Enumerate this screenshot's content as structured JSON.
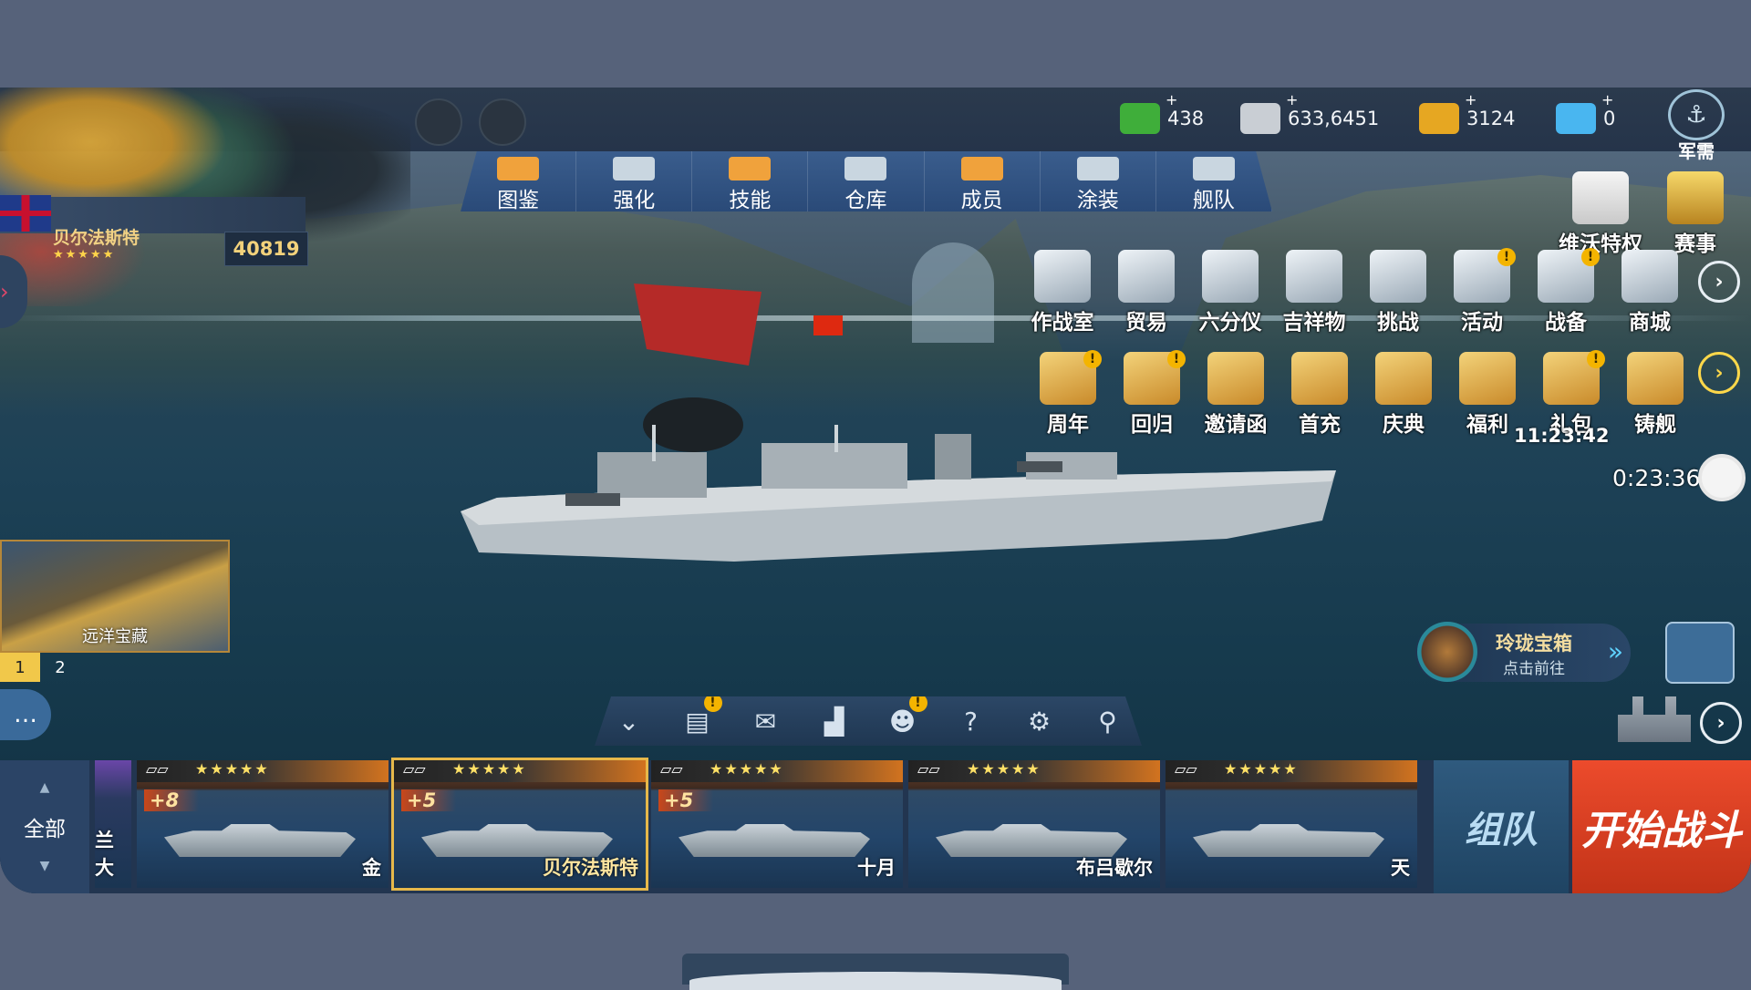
{
  "resources": [
    {
      "icon": "cash-icon",
      "value": "438",
      "color": "#3fae3a"
    },
    {
      "icon": "silver-coins-icon",
      "value": "633,6451",
      "color": "#c9ced4"
    },
    {
      "icon": "gold-coins-icon",
      "value": "3124",
      "color": "#e6a722"
    },
    {
      "icon": "diamond-icon",
      "value": "0",
      "color": "#49b6f0"
    }
  ],
  "resource_plus": "+",
  "junxu_label": "军需",
  "player": {
    "name": "贝尔法斯特",
    "stars": "★★★★★",
    "power": "40819"
  },
  "tabs": [
    {
      "label": "图鉴",
      "icon": "book-icon",
      "color": "#f0a23c"
    },
    {
      "label": "强化",
      "icon": "upgrade-icon",
      "color": "#c9d6e0"
    },
    {
      "label": "技能",
      "icon": "skill-icon",
      "color": "#f0a23c"
    },
    {
      "label": "仓库",
      "icon": "warehouse-icon",
      "color": "#c9d6e0"
    },
    {
      "label": "成员",
      "icon": "crew-icon",
      "color": "#f0a23c"
    },
    {
      "label": "涂装",
      "icon": "paint-flag-icon",
      "color": "#c9d6e0"
    },
    {
      "label": "舰队",
      "icon": "fleet-flag-icon",
      "color": "#c9d6e0"
    }
  ],
  "top_right": [
    {
      "label": "维沃特权",
      "icon": "phone-privilege-icon"
    },
    {
      "label": "赛事",
      "icon": "trophy-icon"
    }
  ],
  "menu_row1": [
    {
      "label": "作战室",
      "icon": "war-room-icon",
      "badge": ""
    },
    {
      "label": "贸易",
      "icon": "scale-icon",
      "badge": ""
    },
    {
      "label": "六分仪",
      "icon": "sextant-icon",
      "badge": ""
    },
    {
      "label": "吉祥物",
      "icon": "mascot-icon",
      "badge": ""
    },
    {
      "label": "挑战",
      "icon": "challenge-wings-icon",
      "badge": ""
    },
    {
      "label": "活动",
      "icon": "megaphone-icon",
      "badge": "!"
    },
    {
      "label": "战备",
      "icon": "book-supply-icon",
      "badge": "!"
    },
    {
      "label": "商城",
      "icon": "cart-icon",
      "badge": ""
    }
  ],
  "menu_row2": [
    {
      "label": "周年",
      "icon": "anniversary-gift-icon",
      "badge": "!"
    },
    {
      "label": "回归",
      "icon": "return-letter-icon",
      "badge": "!"
    },
    {
      "label": "邀请函",
      "icon": "invitation-icon",
      "badge": ""
    },
    {
      "label": "首充",
      "icon": "first-recharge-icon",
      "badge": ""
    },
    {
      "label": "庆典",
      "icon": "celebration-icon",
      "badge": ""
    },
    {
      "label": "福利",
      "icon": "welfare-chest-icon",
      "badge": ""
    },
    {
      "label": "礼包",
      "icon": "gift-pack-icon",
      "badge": "!"
    },
    {
      "label": "铸舰",
      "icon": "forge-icon",
      "badge": ""
    }
  ],
  "gift_timer": "11:23:42",
  "countdown": "0:23:36",
  "treasure": {
    "label": "远洋宝藏",
    "pages": [
      "1",
      "2"
    ]
  },
  "chat_icon": "chat-bubble-icon",
  "tools": [
    {
      "icon": "collapse-chevrons-icon",
      "glyph": "⌄",
      "badge": ""
    },
    {
      "icon": "clipboard-icon",
      "glyph": "▤",
      "badge": "!"
    },
    {
      "icon": "mail-icon",
      "glyph": "✉",
      "badge": ""
    },
    {
      "icon": "ranking-icon",
      "glyph": "▟",
      "badge": ""
    },
    {
      "icon": "friends-icon",
      "glyph": "☻",
      "badge": "!"
    },
    {
      "icon": "help-icon",
      "glyph": "?",
      "badge": ""
    },
    {
      "icon": "settings-gear-icon",
      "glyph": "⚙",
      "badge": ""
    },
    {
      "icon": "location-pin-icon",
      "glyph": "⚲",
      "badge": ""
    }
  ],
  "promo": {
    "title": "玲珑宝箱",
    "subtitle": "点击前往",
    "go": "»"
  },
  "fleet": {
    "filter_label": "全部",
    "cards": [
      {
        "name": "兰大",
        "level": "",
        "stars": "",
        "stub": true
      },
      {
        "name": "金",
        "level": "+8",
        "stars": "★★★★★"
      },
      {
        "name": "贝尔法斯特",
        "level": "+5",
        "stars": "★★★★★",
        "selected": true
      },
      {
        "name": "十月",
        "level": "+5",
        "stars": "★★★★★"
      },
      {
        "name": "布吕歇尔",
        "level": "",
        "stars": "★★★★★"
      },
      {
        "name": "天",
        "level": "",
        "stars": "★★★★★"
      }
    ],
    "team_button": "组队",
    "fight_button": "开始战斗"
  }
}
